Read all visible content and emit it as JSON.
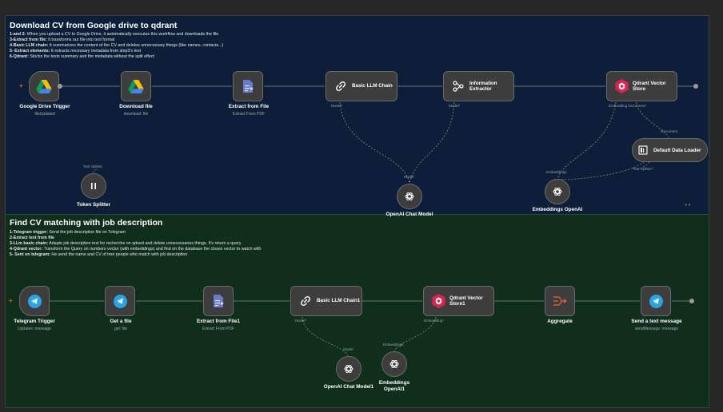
{
  "section1": {
    "title": "Download CV from Google drive to qdrant",
    "lines": [
      {
        "b": "1-and 2-",
        "t": " When you upload a CV to Google Drive, it automatically executes this workflow and downloads the file"
      },
      {
        "b": "3-Extract from file:",
        "t": " it transforms our file into text format"
      },
      {
        "b": "4-Basic LLM chain:",
        "t": " It summarizes the content of the CV and deletes unnecessary things (like names, contacts...)"
      },
      {
        "b": "5- Extract elements:",
        "t": " It extracts necessary metadata from step3's text"
      },
      {
        "b": "6-Qdrant:",
        "t": " Stocks the texts summary and the metadata without the split effect"
      }
    ]
  },
  "section2": {
    "title": "Find CV matching with job description",
    "lines": [
      {
        "b": "1-Telegram trigger:",
        "t": " Send the job description file on Telegram"
      },
      {
        "b": "2-Extract text from file",
        "t": ""
      },
      {
        "b": "3-LLm basic chain:",
        "t": " Adapte job description text for recherche on qdrant and delete unnecessaries things. It's return a query"
      },
      {
        "b": "4-Qdrant vector:",
        "t": " Transform the Query on numbers vector (with embeddings) and find on the database the closes vector to watch with"
      },
      {
        "b": "5- Sent on telegram:",
        "t": " He send the name and CV of tree people who match with job description"
      }
    ]
  },
  "nodes": {
    "gdrive_trigger": {
      "title": "Google Drive Trigger",
      "sub": "fileUpdated"
    },
    "download_file": {
      "title": "Download file",
      "sub": "download: file"
    },
    "extract_pdf": {
      "title": "Extract from File",
      "sub": "Extract From PDF"
    },
    "basic_llm": {
      "title": "Basic LLM Chain"
    },
    "info_extractor": {
      "title": "Information Extractor"
    },
    "qdrant_store": {
      "title": "Qdrant Vector Store"
    },
    "default_loader": {
      "title": "Default Data Loader"
    },
    "token_splitter": {
      "title": "Token Splitter"
    },
    "openai_model": {
      "title": "OpenAI Chat Model"
    },
    "embeddings": {
      "title": "Embeddings OpenAI"
    },
    "tg_trigger": {
      "title": "Telegram Trigger",
      "sub": "Updates: message"
    },
    "get_file": {
      "title": "Get a file",
      "sub": "get: file"
    },
    "extract_pdf1": {
      "title": "Extract from File1",
      "sub": "Extract From PDF"
    },
    "basic_llm1": {
      "title": "Basic LLM Chain1"
    },
    "qdrant_store1": {
      "title": "Qdrant Vector Store1"
    },
    "aggregate": {
      "title": "Aggregate"
    },
    "send_message": {
      "title": "Send a text message",
      "sub": "sendMessage: message"
    },
    "openai_model1": {
      "title": "OpenAI Chat Model1"
    },
    "embeddings1": {
      "title": "Embeddings OpenAI1"
    }
  },
  "ports": {
    "model": "Model*",
    "embedding_document": "Embedding  Document*",
    "document": "Document",
    "text_splitter": "Text Splitter",
    "text_splitter_req": "Text Splitter*",
    "embeddings": "Embeddings",
    "model_plain": "Model",
    "embedding_req": "Embedding*"
  },
  "colors": {
    "accent": "#e05a3a",
    "telegram": "#2aa3e0",
    "qdrant": "#dc2454"
  }
}
